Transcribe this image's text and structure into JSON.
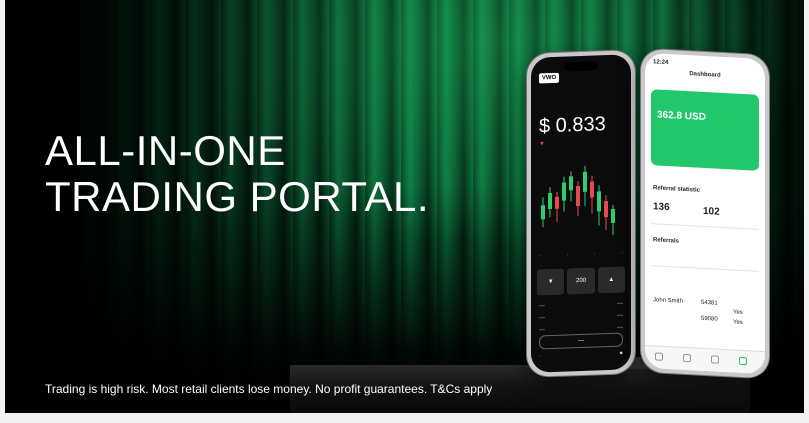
{
  "banner": {
    "headline_line1": "ALL-IN-ONE",
    "headline_line2": "TRADING PORTAL.",
    "disclaimer": "Trading is high risk. Most retail clients lose money. No profit guarantees. T&Cs apply"
  },
  "phone_left": {
    "logo": "VWO",
    "price": "$ 0.833",
    "buy_price": "200"
  },
  "phone_right": {
    "time": "12:24",
    "title": "Dashboard",
    "card_amount": "362.8 USD",
    "section_referral": "Referral statistic",
    "stat_value_1": "136",
    "stat_value_2": "102",
    "section_referrals": "Referrals",
    "row_name_1": "John Smith",
    "row_id_1": "54381",
    "row_id_2": "59080",
    "yes_label": "Yes"
  },
  "colors": {
    "brand_green": "#22c76b",
    "curtain_green": "#0e7a43"
  }
}
